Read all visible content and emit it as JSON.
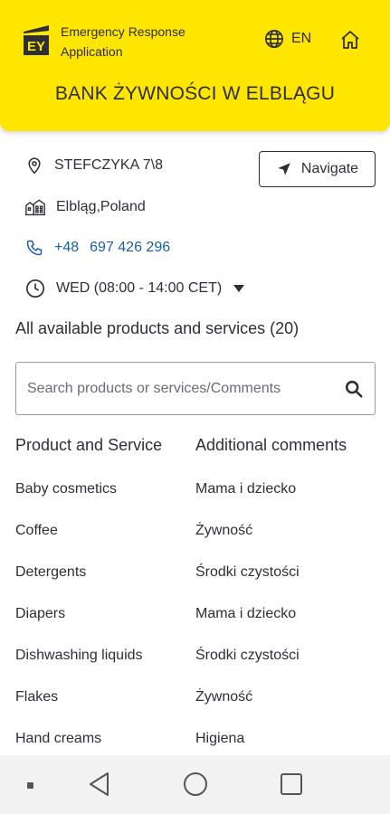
{
  "header": {
    "logo_text": "EY",
    "app_title_line1": "Emergency Response",
    "app_title_line2": "Application",
    "language": "EN",
    "bank_name": "BANK ŻYWNOŚCI W ELBLĄGU",
    "accent_color": "#ffe600"
  },
  "details": {
    "address": "STEFCZYKA 7\\8",
    "city": "Elbląg,Poland",
    "phone_prefix": "+48",
    "phone_number": "697 426 296",
    "hours": "WED (08:00 - 14:00 CET)",
    "navigate_label": "Navigate"
  },
  "products": {
    "heading": "All available products and services (20)",
    "search_placeholder": "Search products or services/Comments",
    "col_product": "Product and Service",
    "col_comments": "Additional comments",
    "rows": [
      {
        "product": "Baby cosmetics",
        "comment": "Mama i dziecko"
      },
      {
        "product": "Coffee",
        "comment": "Żywność"
      },
      {
        "product": "Detergents",
        "comment": "Środki czystości"
      },
      {
        "product": "Diapers",
        "comment": "Mama i dziecko"
      },
      {
        "product": "Dishwashing liquids",
        "comment": "Środki czystości"
      },
      {
        "product": "Flakes",
        "comment": "Żywność"
      },
      {
        "product": "Hand creams",
        "comment": "Higiena"
      }
    ]
  },
  "icons": {
    "location": "location-pin-icon",
    "city": "city-buildings-icon",
    "phone": "phone-icon",
    "clock": "clock-icon",
    "navigate": "navigation-arrow-icon",
    "globe": "globe-icon",
    "home": "home-icon",
    "search": "search-icon"
  }
}
